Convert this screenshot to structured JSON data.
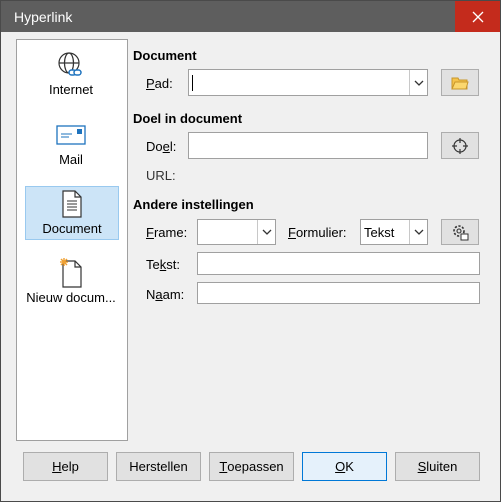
{
  "window": {
    "title": "Hyperlink"
  },
  "sidebar": {
    "items": [
      {
        "label": "Internet",
        "icon": "globe-link-icon"
      },
      {
        "label": "Mail",
        "icon": "envelope-icon"
      },
      {
        "label": "Document",
        "icon": "document-icon",
        "selected": true
      },
      {
        "label": "Nieuw docum...",
        "icon": "new-document-icon"
      }
    ]
  },
  "document_section": {
    "heading": "Document",
    "path_label_ul": "P",
    "path_label_rest": "ad:",
    "path_value": ""
  },
  "target_section": {
    "heading": "Doel in document",
    "target_label_pre": "Do",
    "target_label_ul": "e",
    "target_label_post": "l:",
    "target_value": "",
    "url_label": "URL:"
  },
  "other_section": {
    "heading": "Andere instellingen",
    "frame_label_ul": "F",
    "frame_label_rest": "rame:",
    "frame_value": "",
    "form_label_ul": "F",
    "form_label_rest": "ormulier:",
    "form_value": "Tekst",
    "text_label_pre": "Te",
    "text_label_ul": "k",
    "text_label_post": "st:",
    "text_value": "",
    "name_label_pre": "N",
    "name_label_ul": "a",
    "name_label_post": "am:",
    "name_value": ""
  },
  "buttons": {
    "help_ul": "H",
    "help_rest": "elp",
    "reset": "Herstellen",
    "apply_ul": "T",
    "apply_rest": "oepassen",
    "ok_ul": "O",
    "ok_rest": "K",
    "close_ul": "S",
    "close_rest": "luiten"
  }
}
